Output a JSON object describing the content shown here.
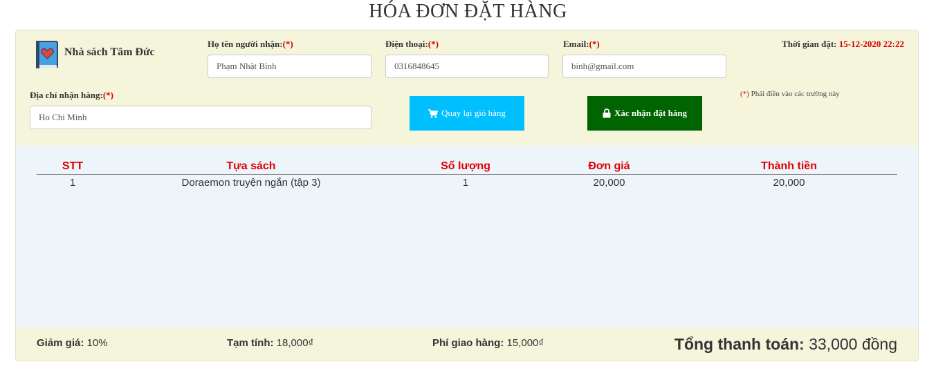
{
  "page": {
    "title": "HÓA ĐƠN ĐẶT HÀNG"
  },
  "store": {
    "name": "Nhà sách Tâm Đức",
    "icon": "book-heart-icon"
  },
  "form": {
    "recipient_label": "Họ tên người nhận:",
    "phone_label": "Điện thoại:",
    "email_label": "Email:",
    "address_label": "Địa chỉ nhận hàng:",
    "required_mark": "(*)",
    "recipient_value": "Phạm Nhật Bình",
    "phone_value": "0316848645",
    "email_value": "binh@gmail.com",
    "address_value": "Ho Chi Minh"
  },
  "order_time": {
    "label": "Thời gian đặt:",
    "value": "15-12-2020 22:22"
  },
  "required_note": {
    "mark": "(*)",
    "text": "Phải điền vào các trường này"
  },
  "buttons": {
    "back_label": "Quay lại giỏ hàng",
    "back_icon": "shopping-cart-icon",
    "confirm_label": "Xác nhận đặt hàng",
    "confirm_icon": "lock-icon"
  },
  "table": {
    "headers": [
      "STT",
      "Tựa sách",
      "Số lượng",
      "Đơn giá",
      "Thành tiền"
    ],
    "rows": [
      [
        "1",
        "Doraemon truyện ngắn (tập 3)",
        "1",
        "20,000",
        "20,000"
      ]
    ]
  },
  "summary": {
    "discount_label": "Giảm giá:",
    "discount_value": "10%",
    "subtotal_label": "Tạm tính:",
    "subtotal_value": "18,000₫",
    "shipping_label": "Phí giao hàng:",
    "shipping_value": "15,000₫",
    "total_label": "Tổng thanh toán:",
    "total_value": "33,000 đồng"
  },
  "colors": {
    "panel_bg": "#f5f5dc",
    "table_bg": "#edf5fb",
    "required_red": "#d40000",
    "header_red": "#e00000",
    "back_button": "#00bfff",
    "confirm_button": "#006400"
  }
}
